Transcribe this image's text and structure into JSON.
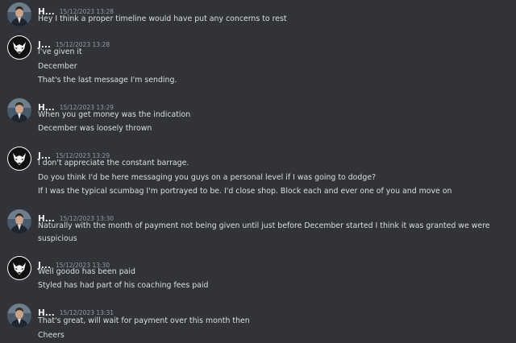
{
  "messages": [
    {
      "username": "H...",
      "avatar": "user-h-avatar",
      "timestamp": "15/12/2023 13:28",
      "lines": [
        "Hey I think a proper timeline would have put any concerns to rest"
      ]
    },
    {
      "username": "J...",
      "avatar": "user-j-wolf-avatar",
      "timestamp": "15/12/2023 13:28",
      "lines": [
        "I've given it",
        "December",
        "That's the last message I'm sending."
      ]
    },
    {
      "username": "H...",
      "avatar": "user-h-avatar",
      "timestamp": "15/12/2023 13:29",
      "lines": [
        "When you get money was the indication",
        "December was loosely thrown"
      ]
    },
    {
      "username": "J...",
      "avatar": "user-j-wolf-avatar",
      "timestamp": "15/12/2023 13:29",
      "lines": [
        "I don't appreciate the constant barrage.",
        "Do you think I'd be here messaging you guys on a personal level if I was going to dodge?",
        "If I was the typical scumbag I'm portrayed to be. I'd close shop. Block each and ever one of you and move on"
      ]
    },
    {
      "username": "H...",
      "avatar": "user-h-avatar",
      "timestamp": "15/12/2023 13:30",
      "lines": [
        "Naturally with the month of payment not being given until just before December started I think it was granted we were suspicious"
      ]
    },
    {
      "username": "J...",
      "avatar": "user-j-wolf-avatar",
      "timestamp": "15/12/2023 13:30",
      "lines": [
        "Well goodo has been paid",
        "Styled has had part of his coaching fees paid"
      ]
    },
    {
      "username": "H...",
      "avatar": "user-h-avatar",
      "timestamp": "15/12/2023 13:31",
      "lines": [
        "That's great, will wait for payment over this month then",
        "Cheers"
      ]
    }
  ],
  "colors": {
    "background": "#313338",
    "text": "#dbdee1",
    "username": "#f2f3f5",
    "timestamp": "#949ba4"
  }
}
